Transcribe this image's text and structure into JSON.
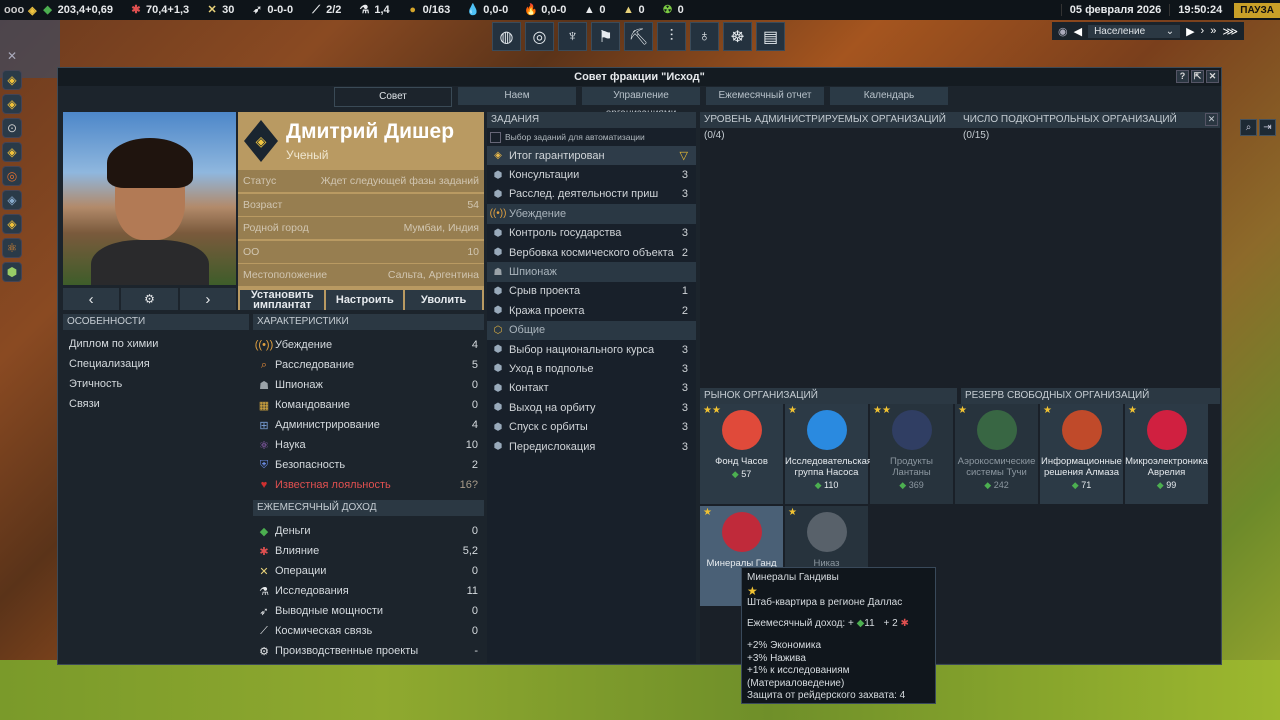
{
  "topbar": {
    "menu": "ooo",
    "resources": [
      {
        "icon": "money-icon",
        "value": "203,4+0,69",
        "color": "#4caf50",
        "glyph": "◆"
      },
      {
        "icon": "influence-icon",
        "value": "70,4+1,3",
        "color": "#e05050",
        "glyph": "✱"
      },
      {
        "icon": "operations-icon",
        "value": "30",
        "color": "#e8d27a",
        "glyph": "✕"
      },
      {
        "icon": "boost-icon",
        "value": "0-0-0",
        "color": "#e8eaec",
        "glyph": "➶"
      },
      {
        "icon": "mission-control-icon",
        "value": "2/2",
        "color": "#e8eaec",
        "glyph": "⟋"
      },
      {
        "icon": "research-icon",
        "value": "1,4",
        "color": "#e8eaec",
        "glyph": "⚗"
      },
      {
        "icon": "projects-icon",
        "value": "0/163",
        "color": "#d4a52a",
        "glyph": "●"
      },
      {
        "icon": "water-icon",
        "value": "0,0-0",
        "color": "#4aa3e0",
        "glyph": "💧"
      },
      {
        "icon": "volatiles-icon",
        "value": "0,0-0",
        "color": "#e05050",
        "glyph": "🔥"
      },
      {
        "icon": "metals-icon",
        "value": "0",
        "color": "#e8eaec",
        "glyph": "▲"
      },
      {
        "icon": "noble-metals-icon",
        "value": "0",
        "color": "#e8d27a",
        "glyph": "▲"
      },
      {
        "icon": "fissiles-icon",
        "value": "0",
        "color": "#7ac943",
        "glyph": "☢"
      }
    ],
    "date": "05 февраля 2026",
    "time": "19:50:24",
    "pause": "ПАУЗА"
  },
  "toolbar": {
    "icons": [
      "globe-icon",
      "target-icon",
      "network-icon",
      "flags-icon",
      "construction-icon",
      "sliders-icon",
      "bulb-icon",
      "brain-icon",
      "report-icon"
    ],
    "dropdown": "Население"
  },
  "window": {
    "title": "Совет фракции \"Исход\"",
    "tabs": [
      "Совет",
      "Наем",
      "Управление организациями",
      "Ежемесячный отчет",
      "Календарь"
    ]
  },
  "leader": {
    "name": "Дмитрий Дишер",
    "role": "Ученый",
    "rows": [
      {
        "label": "Статус",
        "value": "Ждет следующей фазы заданий"
      },
      {
        "label": "Возраст",
        "value": "54"
      },
      {
        "label": "Родной город",
        "value": "Мумбаи, Индия"
      },
      {
        "label": "ОО",
        "value": "10"
      },
      {
        "label": "Местоположение",
        "value": "Сальта, Аргентина"
      }
    ],
    "buttons": {
      "implant": "Установить имплантат",
      "configure": "Настроить",
      "fire": "Уволить"
    }
  },
  "traits": {
    "header": "ОСОБЕННОСТИ",
    "items": [
      "Диплом по химии",
      "Специализация",
      "Этичность",
      "Связи"
    ]
  },
  "attributes": {
    "header": "ХАРАКТЕРИСТИКИ",
    "items": [
      {
        "label": "Убеждение",
        "value": "4",
        "icon": "persuasion-icon",
        "glyph": "((•))",
        "color": "#e0a040"
      },
      {
        "label": "Расследование",
        "value": "5",
        "icon": "investigation-icon",
        "glyph": "⌕",
        "color": "#e08a3a"
      },
      {
        "label": "Шпионаж",
        "value": "0",
        "icon": "espionage-icon",
        "glyph": "☗",
        "color": "#9aa2a8"
      },
      {
        "label": "Командование",
        "value": "0",
        "icon": "command-icon",
        "glyph": "▦",
        "color": "#e0b040"
      },
      {
        "label": "Администрирование",
        "value": "4",
        "icon": "administration-icon",
        "glyph": "⊞",
        "color": "#7aa0d8"
      },
      {
        "label": "Наука",
        "value": "10",
        "icon": "science-icon",
        "glyph": "⚛",
        "color": "#b070d8"
      },
      {
        "label": "Безопасность",
        "value": "2",
        "icon": "security-icon",
        "glyph": "⛨",
        "color": "#6a8ae0"
      },
      {
        "label": "Известная лояльность",
        "value": "16?",
        "icon": "loyalty-icon",
        "glyph": "♥",
        "color": "#d03030"
      }
    ]
  },
  "income": {
    "header": "ЕЖЕМЕСЯЧНЫЙ ДОХОД",
    "items": [
      {
        "label": "Деньги",
        "value": "0",
        "icon": "money-icon",
        "glyph": "◆",
        "color": "#4caf50"
      },
      {
        "label": "Влияние",
        "value": "5,2",
        "icon": "influence-icon",
        "glyph": "✱",
        "color": "#e05050"
      },
      {
        "label": "Операции",
        "value": "0",
        "icon": "operations-icon",
        "glyph": "✕",
        "color": "#e8d27a"
      },
      {
        "label": "Исследования",
        "value": "11",
        "icon": "research-icon",
        "glyph": "⚗",
        "color": "#e8eaec"
      },
      {
        "label": "Выводные мощности",
        "value": "0",
        "icon": "boost-icon",
        "glyph": "➶",
        "color": "#e8eaec"
      },
      {
        "label": "Космическая связь",
        "value": "0",
        "icon": "mission-control-icon",
        "glyph": "⟋",
        "color": "#e8eaec"
      },
      {
        "label": "Производственные проекты",
        "value": "-",
        "icon": "projects-icon",
        "glyph": "⚙",
        "color": "#e8eaec"
      }
    ]
  },
  "tasks": {
    "header": "ЗАДАНИЯ",
    "auto_label": "Выбор заданий для автоматизации",
    "rows": [
      {
        "label": "Итог гарантирован",
        "value": "",
        "type": "sel",
        "icon": "guaranteed-icon",
        "glyph": "◈",
        "color": "#e8b84a"
      },
      {
        "label": "Консультации",
        "value": "3",
        "type": "item",
        "icon": "mission-icon",
        "glyph": "⬢",
        "color": "#9ab"
      },
      {
        "label": "Расслед. деятельности приш",
        "value": "3",
        "type": "item",
        "icon": "mission-icon",
        "glyph": "⬢",
        "color": "#9ab"
      },
      {
        "label": "Убеждение",
        "value": "",
        "type": "cat",
        "icon": "persuasion-icon",
        "glyph": "((•))",
        "color": "#e0a040"
      },
      {
        "label": "Контроль государства",
        "value": "3",
        "type": "item",
        "icon": "mission-icon",
        "glyph": "⬢",
        "color": "#9ab"
      },
      {
        "label": "Вербовка космического объекта",
        "value": "2",
        "type": "item",
        "icon": "mission-icon",
        "glyph": "⬢",
        "color": "#9ab"
      },
      {
        "label": "Шпионаж",
        "value": "",
        "type": "cat",
        "icon": "espionage-icon",
        "glyph": "☗",
        "color": "#9aa2a8"
      },
      {
        "label": "Срыв проекта",
        "value": "1",
        "type": "item",
        "icon": "mission-icon",
        "glyph": "⬢",
        "color": "#9ab"
      },
      {
        "label": "Кража проекта",
        "value": "2",
        "type": "item",
        "icon": "mission-icon",
        "glyph": "⬢",
        "color": "#9ab"
      },
      {
        "label": "Общие",
        "value": "",
        "type": "cat",
        "icon": "general-icon",
        "glyph": "⬡",
        "color": "#e0b040"
      },
      {
        "label": "Выбор национального курса",
        "value": "3",
        "type": "item",
        "icon": "mission-icon",
        "glyph": "⬢",
        "color": "#9ab"
      },
      {
        "label": "Уход в подполье",
        "value": "3",
        "type": "item",
        "icon": "mission-icon",
        "glyph": "⬢",
        "color": "#9ab"
      },
      {
        "label": "Контакт",
        "value": "3",
        "type": "item",
        "icon": "mission-icon",
        "glyph": "⬢",
        "color": "#9ab"
      },
      {
        "label": "Выход на орбиту",
        "value": "3",
        "type": "item",
        "icon": "mission-icon",
        "glyph": "⬢",
        "color": "#9ab"
      },
      {
        "label": "Спуск с орбиты",
        "value": "3",
        "type": "item",
        "icon": "mission-icon",
        "glyph": "⬢",
        "color": "#9ab"
      },
      {
        "label": "Передислокация",
        "value": "3",
        "type": "item",
        "icon": "mission-icon",
        "glyph": "⬢",
        "color": "#9ab"
      }
    ]
  },
  "orgs": {
    "admin_header": "УРОВЕНЬ АДМИНИСТРИРУЕМЫХ ОРГАНИЗАЦИЙ (0/4)",
    "sub_header": "ЧИСЛО ПОДКОНТРОЛЬНЫХ ОРГАНИЗАЦИЙ (0/15)",
    "market_header": "РЫНОК ОРГАНИЗАЦИЙ",
    "reserve_header": "РЕЗЕРВ СВОБОДНЫХ ОРГАНИЗАЦИЙ",
    "cards": [
      {
        "name": "Фонд Часов",
        "stars": "★★",
        "value": "57",
        "faded": false,
        "logo": "#e04a3a"
      },
      {
        "name": "Исследовательская группа Насоса",
        "stars": "★",
        "value": "110",
        "faded": false,
        "logo": "#2a8ae0"
      },
      {
        "name": "Продукты Лантаны",
        "stars": "★★",
        "value": "369",
        "faded": true,
        "logo": "#3a4a8a"
      },
      {
        "name": "Аэрокосмические системы Тучи",
        "stars": "★",
        "value": "242",
        "faded": true,
        "logo": "#4a9a4a"
      },
      {
        "name": "Информационные решения Алмаза",
        "stars": "★",
        "value": "71",
        "faded": false,
        "logo": "#c04a2a"
      },
      {
        "name": "Микроэлектроника Аврелия",
        "stars": "★",
        "value": "99",
        "faded": false,
        "logo": "#d02040"
      },
      {
        "name": "Минералы Ганд",
        "stars": "★",
        "value": "",
        "faded": false,
        "logo": "#c02a3a"
      },
      {
        "name": "Никаз",
        "stars": "★",
        "value": "",
        "faded": true,
        "logo": "#8a9098"
      }
    ]
  },
  "tooltip": {
    "title": "Минералы Гандивы",
    "stars": "★",
    "hq": "Штаб-квартира в регионе Даллас",
    "income_label": "Ежемесячный доход: +",
    "income_money": "11",
    "income_influence": "+ 2",
    "bonus1": "+2% Экономика",
    "bonus2": "+3% Нажива",
    "bonus3": "+1% к исследованиям (Материаловедение)",
    "defense": "Защита от рейдерского захвата: 4"
  }
}
